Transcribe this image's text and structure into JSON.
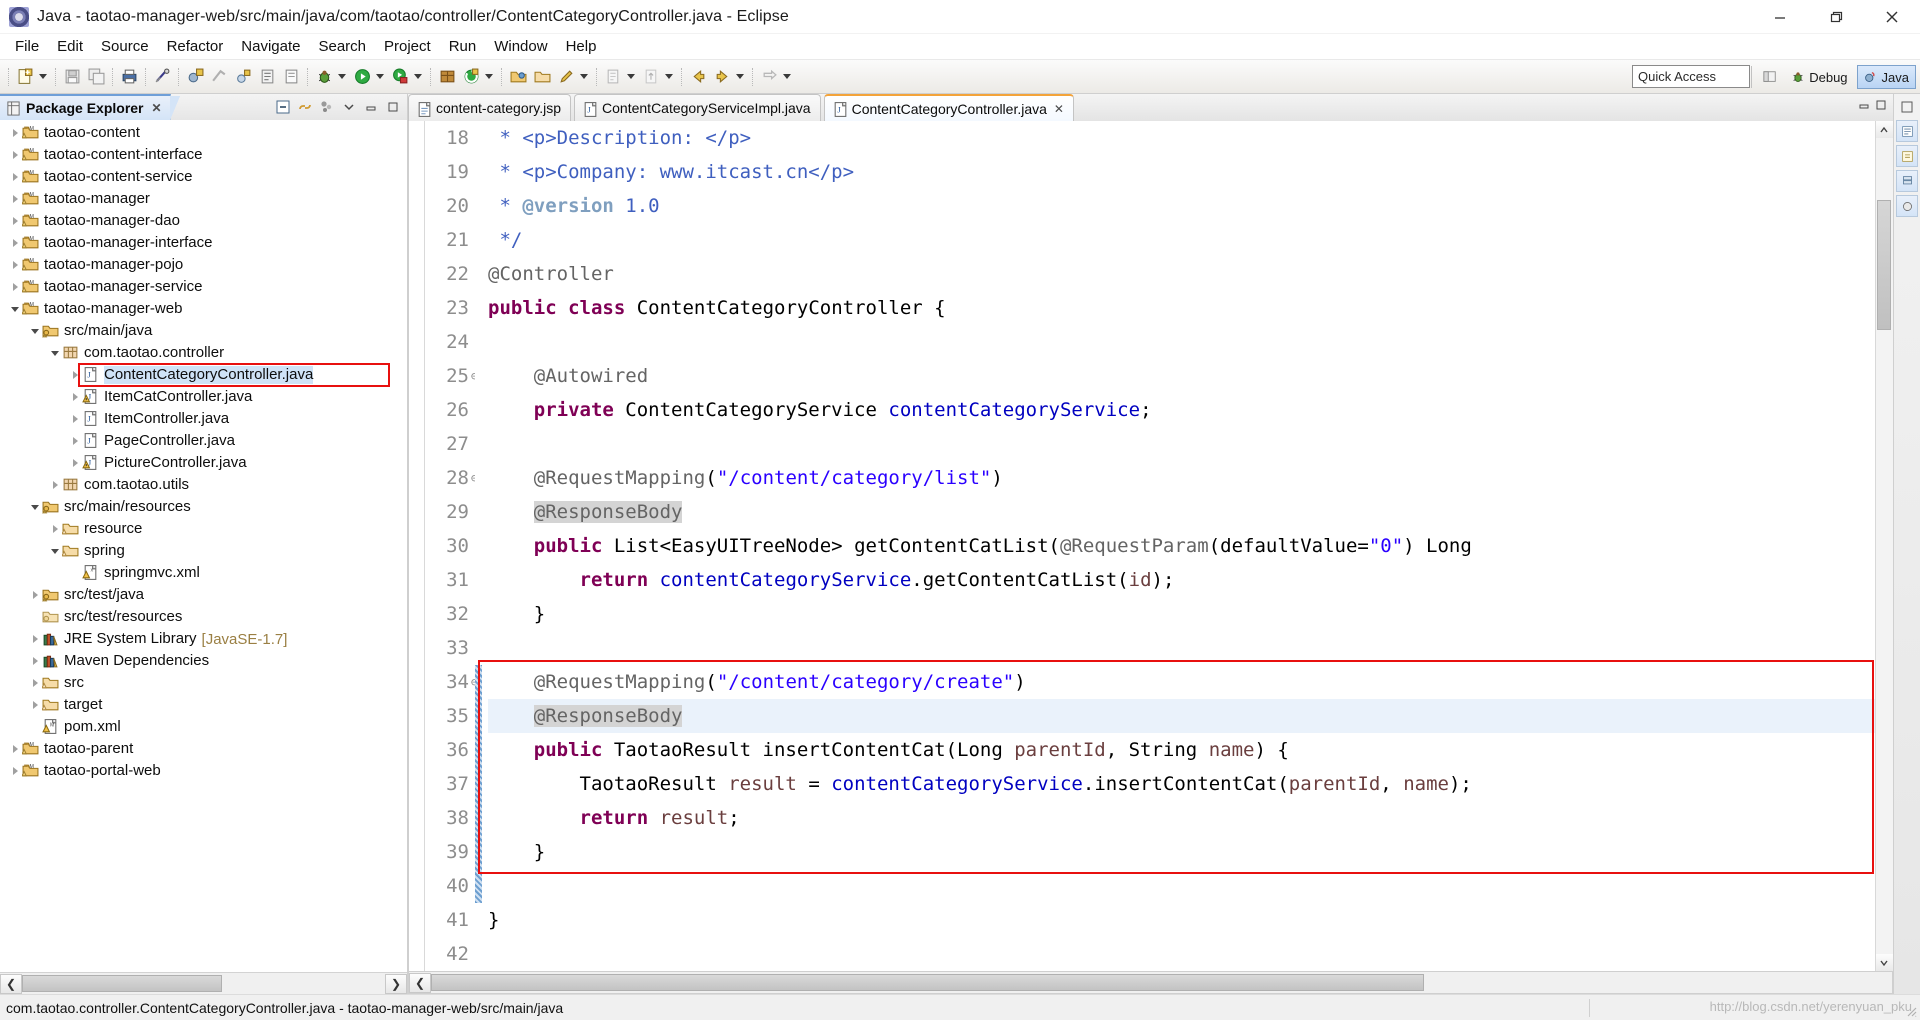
{
  "window": {
    "title": "Java - taotao-manager-web/src/main/java/com/taotao/controller/ContentCategoryController.java - Eclipse",
    "app_icon": "eclipse-icon",
    "minimize_label": "Minimize",
    "maximize_label": "Restore",
    "close_label": "Close"
  },
  "menubar": {
    "items": [
      {
        "label": "File"
      },
      {
        "label": "Edit"
      },
      {
        "label": "Source"
      },
      {
        "label": "Refactor"
      },
      {
        "label": "Navigate"
      },
      {
        "label": "Search"
      },
      {
        "label": "Project"
      },
      {
        "label": "Run"
      },
      {
        "label": "Window"
      },
      {
        "label": "Help"
      }
    ]
  },
  "toolbar": {
    "quick_access_placeholder": "Quick Access",
    "quick_access_value": "",
    "open_perspective_label": "Open Perspective",
    "perspectives": [
      {
        "label": "Debug",
        "icon": "debug-perspective-icon",
        "active": false
      },
      {
        "label": "Java",
        "icon": "java-perspective-icon",
        "active": true
      }
    ],
    "buttons": [
      {
        "name": "new-wizard",
        "icon": "new-icon",
        "has_dropdown": true
      },
      {
        "name": "save",
        "icon": "save-icon",
        "has_dropdown": false
      },
      {
        "name": "save-all",
        "icon": "save-all-icon",
        "has_dropdown": false
      },
      {
        "name": "print",
        "icon": "print-icon",
        "has_dropdown": false
      },
      {
        "name": "toggle-mark-occurrences",
        "icon": "mark-occurrences-icon",
        "has_dropdown": false
      },
      {
        "name": "new-java-project",
        "icon": "new-java-project-icon",
        "has_dropdown": false
      },
      {
        "name": "new-package",
        "icon": "new-package-icon",
        "has_dropdown": false
      },
      {
        "name": "new-class",
        "icon": "new-class-icon",
        "has_dropdown": false
      },
      {
        "name": "open-type",
        "icon": "open-type-icon",
        "has_dropdown": false
      },
      {
        "name": "open-task",
        "icon": "open-task-icon",
        "has_dropdown": false
      },
      {
        "name": "debug",
        "icon": "debug-icon",
        "has_dropdown": true
      },
      {
        "name": "run",
        "icon": "run-icon",
        "has_dropdown": true
      },
      {
        "name": "run-coverage",
        "icon": "coverage-icon",
        "has_dropdown": true
      },
      {
        "name": "new-maven-project",
        "icon": "maven-icon",
        "has_dropdown": false
      },
      {
        "name": "external-tools",
        "icon": "external-tools-icon",
        "has_dropdown": true
      },
      {
        "name": "open-folder",
        "icon": "open-folder-icon",
        "has_dropdown": false
      },
      {
        "name": "open-resource",
        "icon": "open-resource-icon",
        "has_dropdown": false
      },
      {
        "name": "search",
        "icon": "search-pencil-icon",
        "has_dropdown": true
      },
      {
        "name": "next-annotation",
        "icon": "next-annotation-icon",
        "has_dropdown": true
      },
      {
        "name": "previous-annotation",
        "icon": "previous-annotation-icon",
        "has_dropdown": true
      },
      {
        "name": "back",
        "icon": "back-arrow-icon",
        "has_dropdown": false
      },
      {
        "name": "forward",
        "icon": "forward-arrow-icon",
        "has_dropdown": true
      },
      {
        "name": "last-edit-location",
        "icon": "last-edit-icon",
        "has_dropdown": true
      }
    ]
  },
  "explorer": {
    "tab_label": "Package Explorer",
    "tab_icon": "package-explorer-icon",
    "tab_close": "✕",
    "tools": [
      {
        "name": "collapse-all",
        "icon": "collapse-all-icon"
      },
      {
        "name": "link-with-editor",
        "icon": "link-editor-icon"
      },
      {
        "name": "view-menu-filters",
        "icon": "filters-icon"
      },
      {
        "name": "view-menu",
        "icon": "view-menu-icon"
      },
      {
        "name": "minimize-view",
        "icon": "minimize-icon"
      },
      {
        "name": "maximize-view",
        "icon": "maximize-icon"
      }
    ],
    "tree": [
      {
        "label": "taotao-content",
        "icon": "maven-project-icon",
        "indent": 0,
        "state": "collapsed"
      },
      {
        "label": "taotao-content-interface",
        "icon": "maven-project-icon",
        "indent": 0,
        "state": "collapsed"
      },
      {
        "label": "taotao-content-service",
        "icon": "maven-project-icon",
        "indent": 0,
        "state": "collapsed"
      },
      {
        "label": "taotao-manager",
        "icon": "maven-project-icon",
        "indent": 0,
        "state": "collapsed"
      },
      {
        "label": "taotao-manager-dao",
        "icon": "maven-project-icon",
        "indent": 0,
        "state": "collapsed"
      },
      {
        "label": "taotao-manager-interface",
        "icon": "maven-project-icon",
        "indent": 0,
        "state": "collapsed"
      },
      {
        "label": "taotao-manager-pojo",
        "icon": "maven-project-icon",
        "indent": 0,
        "state": "collapsed"
      },
      {
        "label": "taotao-manager-service",
        "icon": "maven-project-icon",
        "indent": 0,
        "state": "collapsed"
      },
      {
        "label": "taotao-manager-web",
        "icon": "maven-project-icon",
        "indent": 0,
        "state": "expanded"
      },
      {
        "label": "src/main/java",
        "icon": "source-folder-icon",
        "indent": 1,
        "state": "expanded"
      },
      {
        "label": "com.taotao.controller",
        "icon": "package-icon",
        "indent": 2,
        "state": "expanded"
      },
      {
        "label": "ContentCategoryController.java",
        "icon": "java-file-icon",
        "indent": 3,
        "state": "collapsed",
        "selected": true,
        "highlighted": true
      },
      {
        "label": "ItemCatController.java",
        "icon": "java-file-warning-icon",
        "indent": 3,
        "state": "collapsed"
      },
      {
        "label": "ItemController.java",
        "icon": "java-file-icon",
        "indent": 3,
        "state": "collapsed"
      },
      {
        "label": "PageController.java",
        "icon": "java-file-icon",
        "indent": 3,
        "state": "collapsed"
      },
      {
        "label": "PictureController.java",
        "icon": "java-file-warning-icon",
        "indent": 3,
        "state": "collapsed"
      },
      {
        "label": "com.taotao.utils",
        "icon": "package-icon",
        "indent": 2,
        "state": "collapsed"
      },
      {
        "label": "src/main/resources",
        "icon": "source-folder-icon",
        "indent": 1,
        "state": "expanded"
      },
      {
        "label": "resource",
        "icon": "folder-icon",
        "indent": 2,
        "state": "collapsed"
      },
      {
        "label": "spring",
        "icon": "folder-icon",
        "indent": 2,
        "state": "expanded"
      },
      {
        "label": "springmvc.xml",
        "icon": "xml-file-icon",
        "indent": 3,
        "state": "leaf"
      },
      {
        "label": "src/test/java",
        "icon": "source-folder-icon",
        "indent": 1,
        "state": "collapsed"
      },
      {
        "label": "src/test/resources",
        "icon": "source-folder-dim-icon",
        "indent": 1,
        "state": "leaf"
      },
      {
        "label": "JRE System Library",
        "suffix": "[JavaSE-1.7]",
        "icon": "library-icon",
        "indent": 1,
        "state": "collapsed"
      },
      {
        "label": "Maven Dependencies",
        "icon": "library-icon",
        "indent": 1,
        "state": "collapsed"
      },
      {
        "label": "src",
        "icon": "folder-icon",
        "indent": 1,
        "state": "collapsed"
      },
      {
        "label": "target",
        "icon": "folder-icon",
        "indent": 1,
        "state": "collapsed"
      },
      {
        "label": "pom.xml",
        "icon": "maven-pom-icon",
        "indent": 1,
        "state": "leaf"
      },
      {
        "label": "taotao-parent",
        "icon": "maven-project-icon",
        "indent": 0,
        "state": "collapsed"
      },
      {
        "label": "taotao-portal-web",
        "icon": "maven-project-icon",
        "indent": 0,
        "state": "collapsed"
      }
    ]
  },
  "editor": {
    "tabs": [
      {
        "label": "content-category.jsp",
        "icon": "jsp-file-icon",
        "active": false,
        "closable": false
      },
      {
        "label": "ContentCategoryServiceImpl.java",
        "icon": "java-file-icon",
        "active": false,
        "closable": false
      },
      {
        "label": "ContentCategoryController.java",
        "icon": "java-file-icon",
        "active": true,
        "closable": true,
        "close_glyph": "✕"
      }
    ],
    "tools": [
      {
        "name": "minimize-editor",
        "icon": "minimize-icon"
      },
      {
        "name": "maximize-editor",
        "icon": "maximize-icon"
      }
    ],
    "first_visible_line": 18,
    "current_line": 35,
    "lines": [
      {
        "n": 18,
        "fold": "",
        "tokens": [
          {
            "t": " * ",
            "c": "cmt"
          },
          {
            "t": "<p>Description: </p>",
            "c": "cmt"
          }
        ]
      },
      {
        "n": 19,
        "fold": "",
        "tokens": [
          {
            "t": " * ",
            "c": "cmt"
          },
          {
            "t": "<p>Company: www.itcast.cn</p>",
            "c": "cmt"
          }
        ]
      },
      {
        "n": 20,
        "fold": "",
        "tokens": [
          {
            "t": " * ",
            "c": "cmt"
          },
          {
            "t": "@version",
            "c": "cmt-kw"
          },
          {
            "t": " 1.0",
            "c": "cmt"
          }
        ]
      },
      {
        "n": 21,
        "fold": "",
        "tokens": [
          {
            "t": " */",
            "c": "cmt"
          }
        ]
      },
      {
        "n": 22,
        "fold": "",
        "tokens": [
          {
            "t": "@Controller",
            "c": "ann"
          }
        ]
      },
      {
        "n": 23,
        "fold": "",
        "tokens": [
          {
            "t": "public",
            "c": "kw"
          },
          {
            "t": " ",
            "c": "plain"
          },
          {
            "t": "class",
            "c": "kw"
          },
          {
            "t": " ContentCategoryController {",
            "c": "plain"
          }
        ]
      },
      {
        "n": 24,
        "fold": "",
        "tokens": []
      },
      {
        "n": 25,
        "fold": "⊖",
        "tokens": [
          {
            "t": "    ",
            "c": "plain"
          },
          {
            "t": "@Autowired",
            "c": "ann"
          }
        ]
      },
      {
        "n": 26,
        "fold": "",
        "tokens": [
          {
            "t": "    ",
            "c": "plain"
          },
          {
            "t": "private",
            "c": "kw"
          },
          {
            "t": " ContentCategoryService ",
            "c": "plain"
          },
          {
            "t": "contentCategoryService",
            "c": "fld"
          },
          {
            "t": ";",
            "c": "plain"
          }
        ]
      },
      {
        "n": 27,
        "fold": "",
        "tokens": []
      },
      {
        "n": 28,
        "fold": "⊖",
        "tokens": [
          {
            "t": "    ",
            "c": "plain"
          },
          {
            "t": "@RequestMapping",
            "c": "ann"
          },
          {
            "t": "(",
            "c": "plain"
          },
          {
            "t": "\"/content/category/list\"",
            "c": "str"
          },
          {
            "t": ")",
            "c": "plain"
          }
        ]
      },
      {
        "n": 29,
        "fold": "",
        "tokens": [
          {
            "t": "    ",
            "c": "plain"
          },
          {
            "t": "@ResponseBody",
            "c": "ann occ"
          }
        ]
      },
      {
        "n": 30,
        "fold": "",
        "tokens": [
          {
            "t": "    ",
            "c": "plain"
          },
          {
            "t": "public",
            "c": "kw"
          },
          {
            "t": " List<EasyUITreeNode> getContentCatList(",
            "c": "plain"
          },
          {
            "t": "@RequestParam",
            "c": "ann"
          },
          {
            "t": "(defaultValue=",
            "c": "plain"
          },
          {
            "t": "\"0\"",
            "c": "str"
          },
          {
            "t": ") Long",
            "c": "plain"
          }
        ]
      },
      {
        "n": 31,
        "fold": "",
        "tokens": [
          {
            "t": "        ",
            "c": "plain"
          },
          {
            "t": "return",
            "c": "kw"
          },
          {
            "t": " ",
            "c": "plain"
          },
          {
            "t": "contentCategoryService",
            "c": "fld"
          },
          {
            "t": ".getContentCatList(",
            "c": "plain"
          },
          {
            "t": "id",
            "c": "loc"
          },
          {
            "t": ");",
            "c": "plain"
          }
        ]
      },
      {
        "n": 32,
        "fold": "",
        "tokens": [
          {
            "t": "    }",
            "c": "plain"
          }
        ]
      },
      {
        "n": 33,
        "fold": "",
        "tokens": []
      },
      {
        "n": 34,
        "fold": "⊖",
        "tokens": [
          {
            "t": "    ",
            "c": "plain"
          },
          {
            "t": "@RequestMapping",
            "c": "ann"
          },
          {
            "t": "(",
            "c": "plain"
          },
          {
            "t": "\"/content/category/create\"",
            "c": "str"
          },
          {
            "t": ")",
            "c": "plain"
          }
        ]
      },
      {
        "n": 35,
        "fold": "",
        "tokens": [
          {
            "t": "    ",
            "c": "plain"
          },
          {
            "t": "@ResponseBody",
            "c": "ann occ"
          }
        ]
      },
      {
        "n": 36,
        "fold": "",
        "tokens": [
          {
            "t": "    ",
            "c": "plain"
          },
          {
            "t": "public",
            "c": "kw"
          },
          {
            "t": " TaotaoResult insertContentCat(Long ",
            "c": "plain"
          },
          {
            "t": "parentId",
            "c": "loc"
          },
          {
            "t": ", String ",
            "c": "plain"
          },
          {
            "t": "name",
            "c": "loc"
          },
          {
            "t": ") {",
            "c": "plain"
          }
        ]
      },
      {
        "n": 37,
        "fold": "",
        "tokens": [
          {
            "t": "        ",
            "c": "plain"
          },
          {
            "t": "TaotaoResult ",
            "c": "plain"
          },
          {
            "t": "result",
            "c": "loc"
          },
          {
            "t": " = ",
            "c": "plain"
          },
          {
            "t": "contentCategoryService",
            "c": "fld"
          },
          {
            "t": ".insertContentCat(",
            "c": "plain"
          },
          {
            "t": "parentId",
            "c": "loc"
          },
          {
            "t": ", ",
            "c": "plain"
          },
          {
            "t": "name",
            "c": "loc"
          },
          {
            "t": ");",
            "c": "plain"
          }
        ]
      },
      {
        "n": 38,
        "fold": "",
        "tokens": [
          {
            "t": "        ",
            "c": "plain"
          },
          {
            "t": "return",
            "c": "kw"
          },
          {
            "t": " ",
            "c": "plain"
          },
          {
            "t": "result",
            "c": "loc"
          },
          {
            "t": ";",
            "c": "plain"
          }
        ]
      },
      {
        "n": 39,
        "fold": "",
        "tokens": [
          {
            "t": "    }",
            "c": "plain"
          }
        ]
      },
      {
        "n": 40,
        "fold": "",
        "tokens": []
      },
      {
        "n": 41,
        "fold": "",
        "tokens": [
          {
            "t": "}",
            "c": "plain"
          }
        ]
      },
      {
        "n": 42,
        "fold": "",
        "tokens": []
      }
    ]
  },
  "annotations": {
    "box_color": "#e8100f",
    "code_box_lines": [
      34,
      39
    ],
    "tree_box_item": "ContentCategoryController.java"
  },
  "statusbar": {
    "text": "com.taotao.controller.ContentCategoryController.java - taotao-manager-web/src/main/java",
    "watermark": "http://blog.csdn.net/yerenyuan_pku"
  },
  "colors": {
    "annotation_red": "#e8100f",
    "keyword": "#7f0055",
    "string": "#2a00ff",
    "comment": "#3f5fbf",
    "annotation_gray": "#646464",
    "field_blue": "#0000c0",
    "local_brown": "#6a3e3e",
    "current_line": "#eaf2fb",
    "selection": "#cfe3f7",
    "occurrence": "#d4d4d4"
  }
}
